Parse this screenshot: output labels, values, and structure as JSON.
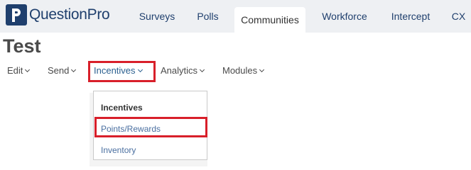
{
  "brand": {
    "name": "QuestionPro"
  },
  "top_nav": {
    "items": [
      {
        "label": "Surveys",
        "active": false
      },
      {
        "label": "Polls",
        "active": false
      },
      {
        "label": "Communities",
        "active": true
      },
      {
        "label": "Workforce",
        "active": false
      },
      {
        "label": "Intercept",
        "active": false
      },
      {
        "label": "CX",
        "active": false
      }
    ]
  },
  "page": {
    "title": "Test"
  },
  "sub_nav": {
    "items": [
      {
        "label": "Edit"
      },
      {
        "label": "Send"
      },
      {
        "label": "Incentives",
        "highlighted": true
      },
      {
        "label": "Analytics"
      },
      {
        "label": "Modules"
      }
    ]
  },
  "incentives_dropdown": {
    "header": "Incentives",
    "items": [
      {
        "label": "Points/Rewards",
        "highlighted": true
      },
      {
        "label": "Inventory"
      }
    ]
  },
  "colors": {
    "brand_navy": "#1f3f6d",
    "highlight_red": "#d81f2a",
    "link_blue": "#2a5f8f"
  }
}
